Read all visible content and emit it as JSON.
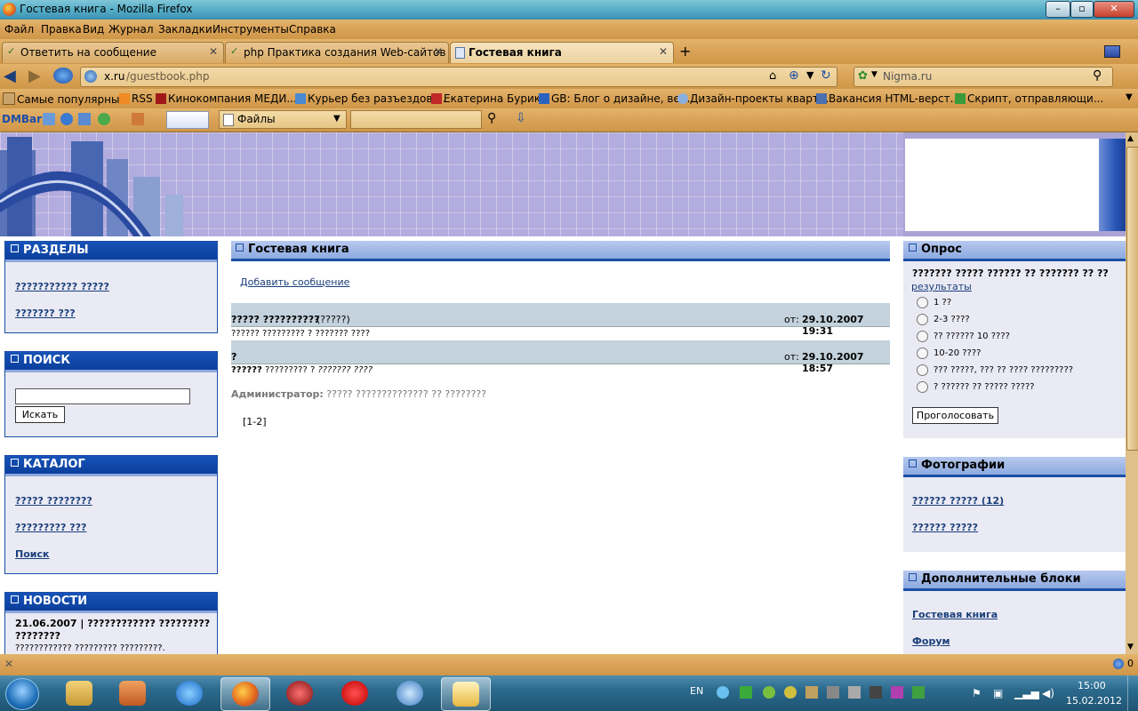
{
  "window": {
    "title": "Гостевая книга - Mozilla Firefox",
    "controls": [
      "–",
      "▫",
      "✕"
    ]
  },
  "menu": [
    "Файл",
    "Правка",
    "Вид",
    "Журнал",
    "Закладки",
    "Инструменты",
    "Справка"
  ],
  "tabs": [
    {
      "label": "Ответить на сообщение",
      "active": false
    },
    {
      "label": "php Практика создания Web-сайтов ...",
      "active": false
    },
    {
      "label": "Гостевая книга",
      "active": true
    }
  ],
  "nav": {
    "url_host": "x.ru",
    "url_path": "/guestbook.php",
    "search_engine": "Nigma.ru"
  },
  "bookmarks": [
    "Самые популярные",
    "RSS",
    "Кинокомпания МЕДИ...",
    "Курьер без разъездов ...",
    "Екатерина Бурика",
    "GB: Блог о дизайне, ве...",
    "Дизайн-проекты кварт...",
    "Вакансия HTML-верст...",
    "Скрипт, отправляющи..."
  ],
  "dmbar": {
    "label": "DMBar",
    "files": "Файлы"
  },
  "left": {
    "sections": {
      "title": "РАЗДЕЛЫ",
      "links": [
        "??????????? ?????",
        "??????? ???"
      ]
    },
    "search": {
      "title": "ПОИСК",
      "button": "Искать",
      "value": ""
    },
    "catalog": {
      "title": "КАТАЛОГ",
      "links": [
        "????? ????????",
        "????????? ???",
        "Поиск"
      ]
    },
    "news": {
      "title": "НОВОСТИ",
      "headline": "21.06.2007 | ???????????? ?????????",
      "headline2": "????????",
      "text": "???????????? ????????? ?????????. ???????????"
    }
  },
  "center": {
    "title": "Гостевая книга",
    "add_link": "Добавить сообщение",
    "messages": [
      {
        "author": "????? ??????????",
        "extra": "(?????)",
        "from_label": "от:",
        "date": "29.10.2007 19:31",
        "body": "?????? ????????? ? ??????? ????"
      },
      {
        "author": "?",
        "extra": "",
        "from_label": "от:",
        "date": "29.10.2007 18:57",
        "body_bold": "??????",
        "body": " ????????? ? ",
        "body_italic": "??????? ????",
        "admin_label": "Администратор:",
        "admin_text": " ????? ?????????????? ?? ????????"
      }
    ],
    "pager": "[1-2]"
  },
  "right": {
    "poll": {
      "title": "Опрос",
      "question": "??????? ????? ?????? ?? ??????? ?? ??",
      "results": "результаты",
      "options": [
        "1 ??",
        "2-3 ????",
        "?? ?????? 10 ????",
        "10-20 ????",
        "??? ?????, ??? ?? ???? ?????????",
        "? ?????? ?? ????? ?????"
      ],
      "vote": "Проголосовать"
    },
    "photos": {
      "title": "Фотографии",
      "links": [
        "?????? ????? (12)",
        "?????? ?????"
      ]
    },
    "extra": {
      "title": "Дополнительные блоки",
      "links": [
        "Гостевая книга",
        "Форум"
      ]
    }
  },
  "status": {
    "left": "✕",
    "right": "0"
  },
  "taskbar": {
    "lang": "EN",
    "time": "15:00",
    "date": "15.02.2012"
  },
  "colors": {
    "box_header": "#1753b8",
    "box_bg": "#eaeaf4",
    "msg_header": "#c3d2dc"
  }
}
